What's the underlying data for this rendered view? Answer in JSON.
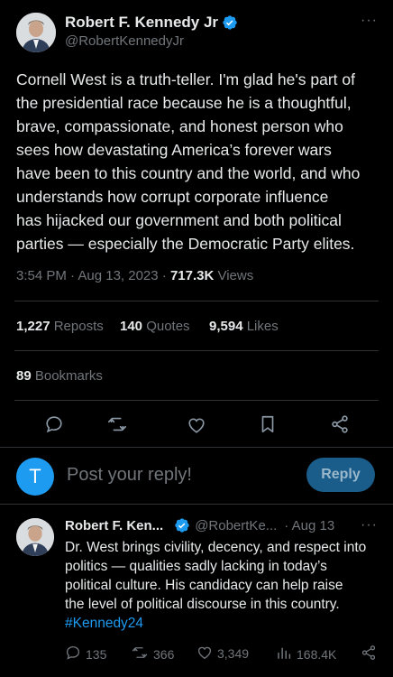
{
  "tweet": {
    "author_name": "Robert F. Kennedy Jr",
    "author_handle": "@RobertKennedyJr",
    "more": "···",
    "text_lines": [
      "Cornell West is a truth-teller. I'm glad he's part of",
      "the presidential race because he is a thoughtful,",
      "brave, compassionate, and honest person who",
      "sees how devastating America’s forever wars",
      "have been to this country and the world, and who",
      "understands how corrupt corporate influence",
      "has hijacked our government and both political",
      "parties — especially the Democratic Party elites."
    ],
    "time": "3:54 PM · Aug 13, 2023 · ",
    "views_count": "717.3K",
    "views_label": " Views"
  },
  "stats": {
    "reposts_count": "1,227",
    "reposts_label": " Reposts",
    "quotes_count": "140",
    "quotes_label": " Quotes",
    "likes_count": "9,594",
    "likes_label": " Likes",
    "bookmarks_count": "89",
    "bookmarks_label": " Bookmarks"
  },
  "actions": {
    "icons": [
      "reply-icon",
      "repost-icon",
      "like-icon",
      "bookmark-icon",
      "share-icon"
    ]
  },
  "compose": {
    "avatar_letter": "T",
    "placeholder": "Post your reply!",
    "button_label": "Reply"
  },
  "reply": {
    "author_name": "Robert F. Ken...",
    "author_handle": "@RobertKe...",
    "date": "· Aug 13",
    "more": "···",
    "lines": [
      "Dr. West brings civility, decency, and respect into",
      "politics — qualities sadly lacking in today’s",
      "political culture. His candidacy can help raise",
      "the level of political discourse in this country."
    ],
    "hashtag": "#Kennedy24",
    "replies": "135",
    "reposts": "366",
    "likes": "3,349",
    "views": "168.4K"
  },
  "colors": {
    "background": "#000000",
    "text": "#e7e9ea",
    "muted": "#71767b",
    "accent": "#1d9bf0",
    "divider": "#2f3336"
  }
}
